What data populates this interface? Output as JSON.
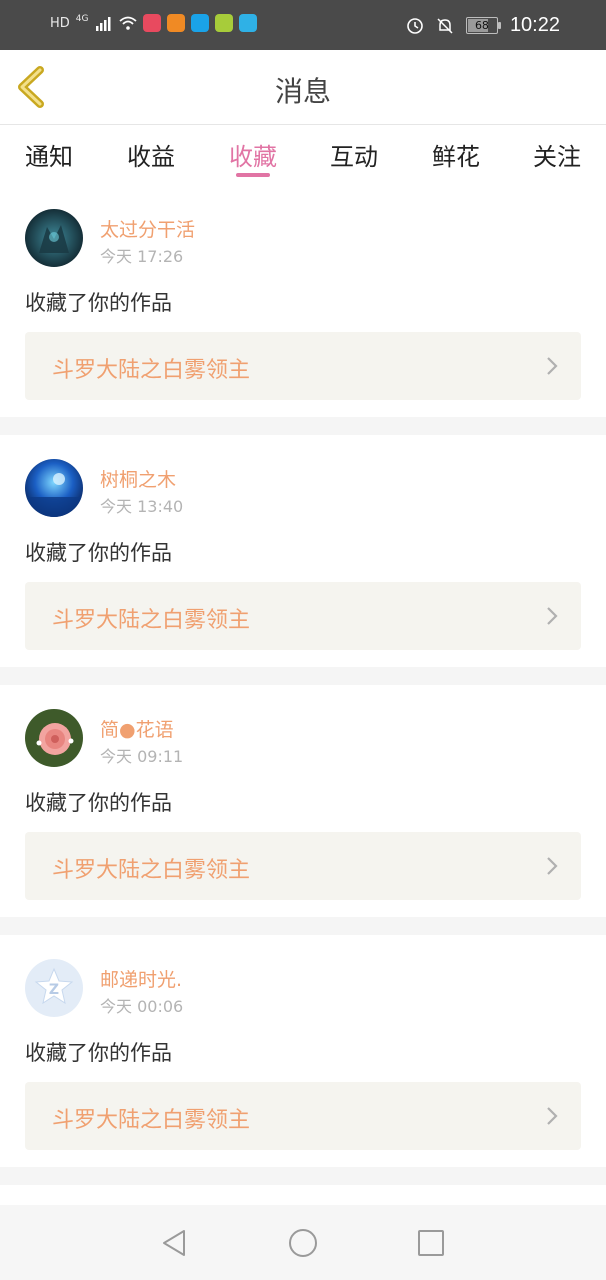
{
  "status_bar": {
    "network_label": "HD",
    "signal_label": "4G",
    "battery": "68",
    "battery_level": 0.68,
    "time": "10:22",
    "app_icon_colors": [
      "#e84a5f",
      "#f08a24",
      "#1aa3e8",
      "#a7cc3a",
      "#2fb1e6"
    ]
  },
  "header": {
    "title": "消息",
    "back_icon": "chevron-left-icon"
  },
  "tabs": [
    {
      "label": "通知",
      "active": false
    },
    {
      "label": "收益",
      "active": false
    },
    {
      "label": "收藏",
      "active": true
    },
    {
      "label": "互动",
      "active": false
    },
    {
      "label": "鲜花",
      "active": false
    },
    {
      "label": "关注",
      "active": false
    }
  ],
  "notifications": [
    {
      "user": "太过分干活",
      "time": "今天 17:26",
      "message": "收藏了你的作品",
      "work": "斗罗大陆之白雾领主",
      "avatar": "dark-dragon-avatar"
    },
    {
      "user": "树桐之木",
      "time": "今天 13:40",
      "message": "收藏了你的作品",
      "work": "斗罗大陆之白雾领主",
      "avatar": "blue-night-avatar"
    },
    {
      "user": "简●花语",
      "time": "今天 09:11",
      "message": "收藏了你的作品",
      "work": "斗罗大陆之白雾领主",
      "avatar": "rose-avatar"
    },
    {
      "user": "邮递时光.",
      "time": "今天 00:06",
      "message": "收藏了你的作品",
      "work": "斗罗大陆之白雾领主",
      "avatar": "default-avatar"
    }
  ],
  "colors": {
    "accent": "#e174a4",
    "username": "#f0a070",
    "work_title": "#f0a070",
    "work_box_bg": "#f5f4ef"
  },
  "system_nav": [
    "back-triangle-icon",
    "home-circle-icon",
    "recents-square-icon"
  ]
}
